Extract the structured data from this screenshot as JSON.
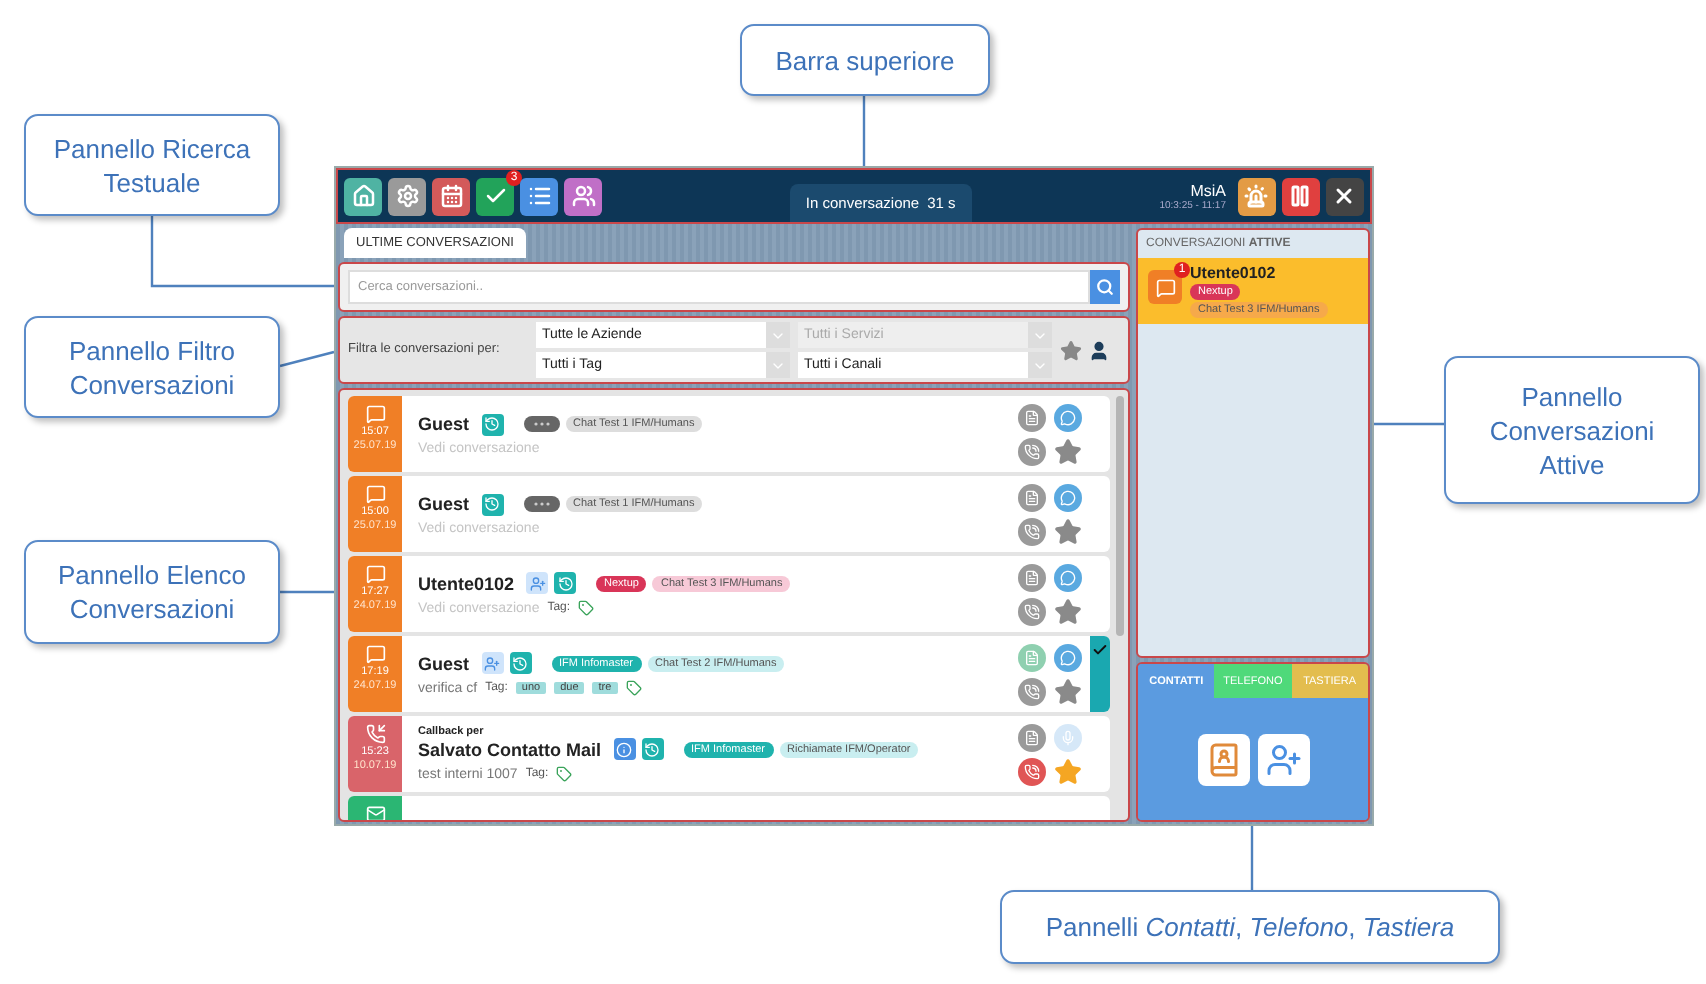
{
  "callouts": [
    {
      "text": "Barra superiore"
    },
    {
      "text": "Pannello Ricerca Testuale"
    },
    {
      "text": "Pannello Filtro Conversazioni"
    },
    {
      "text": "Pannello Elenco Conversazioni"
    },
    {
      "text": "Pannello Conversazioni Attive"
    },
    {
      "text": "Pannelli *Contatti*, *Telefono*, *Tastiera*"
    }
  ],
  "topbar": {
    "apps": [
      {
        "kind": "home"
      },
      {
        "kind": "settings"
      },
      {
        "kind": "calendar"
      },
      {
        "kind": "check",
        "badge": "3"
      },
      {
        "kind": "list"
      },
      {
        "kind": "users"
      }
    ],
    "status": "In conversazione",
    "timer": "31 s",
    "user": "MsiA",
    "clock": "10:3:25 - 11:17",
    "actions": [
      {
        "kind": "siren"
      },
      {
        "kind": "pause"
      },
      {
        "kind": "close"
      }
    ]
  },
  "tabs": [
    {
      "label": "ULTIME CONVERSAZIONI",
      "selected": true
    }
  ],
  "search": {
    "placeholder": "Cerca conversazioni.."
  },
  "filters": {
    "label": "Filtra le conversazioni per:",
    "selects": [
      {
        "value": "Tutte le Aziende",
        "disabled": false
      },
      {
        "value": "Tutti i Servizi",
        "disabled": true
      },
      {
        "value": "Tutti i Tag",
        "disabled": false
      },
      {
        "value": "Tutti i Canali",
        "disabled": false
      }
    ]
  },
  "conversations": [
    {
      "kind": "chat",
      "time": "15:07",
      "date": "25.07.19",
      "name": "Guest",
      "contact": false,
      "info": false,
      "pills": [
        {
          "kind": "more",
          "color": "#666666"
        },
        {
          "kind": "text",
          "text": "Chat Test 1 IFM/Humans",
          "color": "#dddddd"
        }
      ],
      "subtitle": "Vedi conversazione",
      "muted": true,
      "reply": {
        "kind": "chat"
      },
      "callback": false,
      "starred": false,
      "selected": false
    },
    {
      "kind": "chat",
      "time": "15:00",
      "date": "25.07.19",
      "name": "Guest",
      "contact": false,
      "info": false,
      "pills": [
        {
          "kind": "more",
          "color": "#666666"
        },
        {
          "kind": "text",
          "text": "Chat Test 1 IFM/Humans",
          "color": "#dddddd"
        }
      ],
      "subtitle": "Vedi conversazione",
      "muted": true,
      "reply": {
        "kind": "chat"
      },
      "callback": false,
      "starred": false,
      "selected": false
    },
    {
      "kind": "chat",
      "time": "17:27",
      "date": "24.07.19",
      "name": "Utente0102",
      "contact": true,
      "info": false,
      "pills": [
        {
          "kind": "text",
          "text": "Nextup",
          "color": "#d93558"
        },
        {
          "kind": "text",
          "text": "Chat Test 3 IFM/Humans",
          "color": "#f7c9d7"
        }
      ],
      "subtitle": "Vedi conversazione",
      "muted": true,
      "tag_label": "Tag:",
      "reply": {
        "kind": "chat"
      },
      "callback": false,
      "starred": false,
      "selected": false
    },
    {
      "kind": "chat",
      "time": "17:19",
      "date": "24.07.19",
      "name": "Guest",
      "contact": true,
      "info": false,
      "pills": [
        {
          "kind": "text",
          "text": "IFM Infomaster",
          "color": "#1fb3ad"
        },
        {
          "kind": "text",
          "text": "Chat Test 2 IFM/Humans",
          "color": "#c9eef0"
        }
      ],
      "subtitle": "verifica cf",
      "muted": false,
      "tag_label": "Tag:",
      "labels": [
        "uno",
        "due",
        "tre"
      ],
      "reply": {
        "kind": "chat"
      },
      "callback": false,
      "starred": false,
      "selected": true
    },
    {
      "kind": "callback",
      "time": "15:23",
      "date": "10.07.19",
      "prefix": "Callback per",
      "name": "Salvato Contatto Mail",
      "contact": false,
      "info": true,
      "pills": [
        {
          "kind": "text",
          "text": "IFM Infomaster",
          "color": "#1fb3ad"
        },
        {
          "kind": "text",
          "text": "Richiamate IFM/Operator",
          "color": "#c9eef0"
        }
      ],
      "subtitle": "test interni 1007",
      "muted": false,
      "tag_label": "Tag:",
      "reply": {
        "kind": "mic"
      },
      "callback": true,
      "starred": true,
      "selected": false
    },
    {
      "kind": "mail"
    }
  ],
  "active": {
    "heading": "CONVERSAZIONI **ATTIVE**",
    "items": [
      {
        "name": "Utente0102",
        "badge": "1",
        "selected": true,
        "pills": [
          {
            "text": "Nextup",
            "color": "#d93558"
          },
          {
            "text": "Chat Test 3 IFM/Humans",
            "color": "#f6a94a"
          }
        ]
      }
    ]
  },
  "tools": {
    "tabs": [
      {
        "label": "CONTATTI",
        "selected": true,
        "color": "#5b9be0"
      },
      {
        "label": "TELEFONO",
        "selected": false,
        "color": "#4fd97a"
      },
      {
        "label": "TASTIERA",
        "selected": false,
        "color": "#e3bd4e"
      }
    ],
    "buttons": [
      {
        "kind": "address-book"
      },
      {
        "kind": "add-contact"
      }
    ]
  }
}
